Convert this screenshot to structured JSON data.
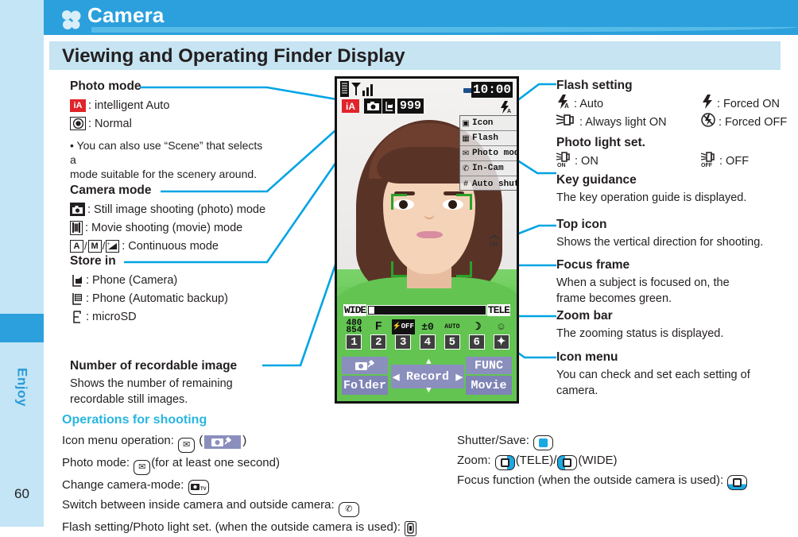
{
  "sidebar": {
    "chapter": "Enjoy",
    "page_number": "60"
  },
  "header": {
    "title": "Camera",
    "icon": "clover-icon"
  },
  "section": {
    "heading": "Viewing and Operating Finder Display"
  },
  "left_column": {
    "photo_mode": {
      "heading": "Photo mode",
      "items": [
        {
          "icon": "intelligent-auto-icon",
          "icon_text": "iA",
          "label": ": intelligent Auto"
        },
        {
          "icon": "normal-mode-icon",
          "icon_text": "◉",
          "label": ": Normal"
        }
      ],
      "note": "• You can also use “Scene” that selects a\n   mode suitable for the scenery around."
    },
    "camera_mode": {
      "heading": "Camera mode",
      "items": [
        {
          "icon": "still-camera-icon",
          "label": ": Still image shooting (photo) mode"
        },
        {
          "icon": "movie-camera-icon",
          "label": ": Movie shooting (movie) mode"
        },
        {
          "icon": "continuous-mode-icons",
          "label": ": Continuous mode",
          "sub_icons": [
            "A",
            "M",
            "+◢"
          ]
        }
      ]
    },
    "store_in": {
      "heading": "Store in",
      "items": [
        {
          "icon": "phone-camera-storage-icon",
          "label": ": Phone (Camera)"
        },
        {
          "icon": "phone-backup-storage-icon",
          "label": ": Phone (Automatic backup)"
        },
        {
          "icon": "microsd-icon",
          "label": ": microSD"
        }
      ]
    },
    "recordable": {
      "heading": "Number of recordable image",
      "body_line1": "Shows the number of remaining",
      "body_line2": "recordable still images."
    }
  },
  "right_column": {
    "flash_setting": {
      "heading": "Flash setting",
      "items": [
        {
          "icon": "flash-auto-icon",
          "label": ": Auto"
        },
        {
          "icon": "flash-forced-on-icon",
          "label": ": Forced ON"
        },
        {
          "icon": "always-light-on-icon",
          "label": ": Always light ON"
        },
        {
          "icon": "flash-forced-off-icon",
          "label": ": Forced OFF"
        }
      ]
    },
    "photo_light": {
      "heading": "Photo light set.",
      "items": [
        {
          "icon": "photo-light-on-icon",
          "label": ": ON"
        },
        {
          "icon": "photo-light-off-icon",
          "label": ": OFF"
        }
      ]
    },
    "key_guidance": {
      "heading": "Key guidance",
      "body": "The key operation guide is displayed."
    },
    "top_icon": {
      "heading": "Top icon",
      "body": "Shows the vertical direction for shooting."
    },
    "focus_frame": {
      "heading": "Focus frame",
      "body_line1": "When a subject is focused on, the",
      "body_line2": "frame becomes green."
    },
    "zoom_bar": {
      "heading": "Zoom bar",
      "body": "The zooming status is displayed."
    },
    "icon_menu": {
      "heading": "Icon menu",
      "body_line1": "You can check and set each setting of",
      "body_line2": "camera."
    }
  },
  "phone_screen": {
    "clock": "10:00",
    "photo_mode_badge": "iA",
    "recordable_count": "999",
    "battery_icon": "battery-icon",
    "signal_icon": "signal-antenna-icon",
    "flash_indicator_icon": "flash-auto-icon",
    "top_icon_label": "TOP",
    "key_guidance_items": [
      {
        "key": "▲",
        "label": "Icon"
      },
      {
        "key": "▦",
        "label": "Flash"
      },
      {
        "key": "✉",
        "label": "Photo mode"
      },
      {
        "key": "✆",
        "label": "In-Cam"
      },
      {
        "key": "#",
        "label": "Auto shutter"
      }
    ],
    "zoom_bar": {
      "wide_label": "WIDE",
      "tele_label": "TELE"
    },
    "icon_menu": [
      {
        "icon_text": "480\n854",
        "number": "1"
      },
      {
        "icon_text": "F",
        "number": "2"
      },
      {
        "icon_text": "⚡OFF",
        "number": "3"
      },
      {
        "icon_text": "±0",
        "number": "4"
      },
      {
        "icon_text": "AUTO",
        "number": "5"
      },
      {
        "icon_text": "☽",
        "number": "6"
      },
      {
        "icon_text": "☺",
        "number": "✦"
      }
    ],
    "soft_keys": {
      "top_left": "camera-settings-icon",
      "bottom_left": "Folder",
      "center": "Record",
      "top_right": "FUNC",
      "bottom_right": "Movie"
    }
  },
  "operations": {
    "heading": "Operations for shooting",
    "left": [
      {
        "text_before": "Icon menu operation: ",
        "key": "mail-key",
        "text_mid": " (",
        "chip": "camera-settings-icon",
        "text_after": ")"
      },
      {
        "text_before": "Photo mode: ",
        "key": "mail-key",
        "text_after": "(for at least one second)"
      },
      {
        "text_before": "Change camera-mode: ",
        "key": "camera-tv-key",
        "text_after": ""
      },
      {
        "text_before": "Switch between inside camera and outside camera: ",
        "key": "call-key",
        "text_after": ""
      },
      {
        "text_before": "Flash setting/Photo light set. (when the outside camera is used): ",
        "key": "side-key",
        "text_after": ""
      }
    ],
    "right": [
      {
        "text_before": "Shutter/Save: ",
        "key": "center-key",
        "text_after": ""
      },
      {
        "text_before": "Zoom: ",
        "key": "right-key",
        "text_mid": "(TELE)/",
        "key2": "left-key",
        "text_after": "(WIDE)"
      },
      {
        "text_before": "Focus function (when the outside camera is used): ",
        "key": "down-key",
        "text_after": ""
      }
    ]
  },
  "colors": {
    "brand_blue": "#2ba0dc",
    "light_blue": "#c3e5f6",
    "band_blue": "#c6e4f2",
    "accent_cyan": "#29b6e0",
    "connector": "#00a4e4",
    "focus_green": "#2aa22a",
    "badge_red": "#e0242a",
    "softkey_purple": "#8b8fbe"
  }
}
